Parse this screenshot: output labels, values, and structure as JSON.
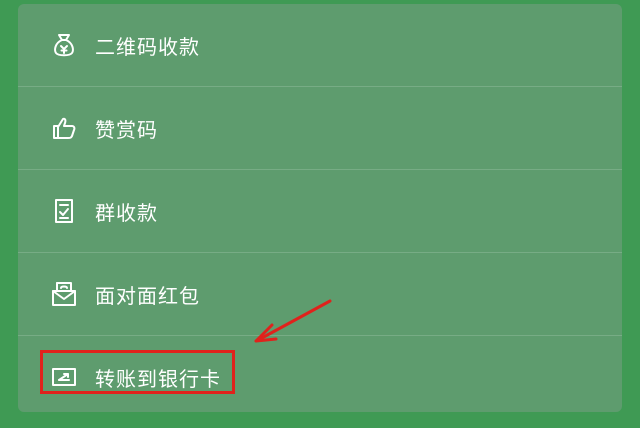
{
  "menu": {
    "items": [
      {
        "label": "二维码收款",
        "icon": "money-bag-icon"
      },
      {
        "label": "赞赏码",
        "icon": "thumbs-up-icon"
      },
      {
        "label": "群收款",
        "icon": "checklist-icon"
      },
      {
        "label": "面对面红包",
        "icon": "red-envelope-icon"
      },
      {
        "label": "转账到银行卡",
        "icon": "bank-card-transfer-icon"
      }
    ]
  },
  "colors": {
    "background": "#3f9a54",
    "panel": "#5e9c6e",
    "text": "#ffffff",
    "annotation": "#e0221c"
  }
}
